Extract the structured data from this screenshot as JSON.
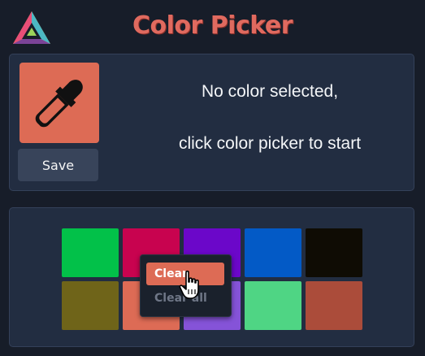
{
  "header": {
    "title": "Color Picker",
    "logo_icon": "prism-triangle-logo-icon"
  },
  "picker": {
    "icon": "eyedropper-icon",
    "button_color": "#dd6b55",
    "save_label": "Save"
  },
  "message": {
    "line1": "No color selected,",
    "line2": "click color picker to start"
  },
  "swatches": [
    {
      "color": "#02c149"
    },
    {
      "color": "#c8034f"
    },
    {
      "color": "#6b07c9"
    },
    {
      "color": "#035ac6"
    },
    {
      "color": "#0f0c04"
    },
    {
      "color": "#6f6419"
    },
    {
      "color": "#dd6b55"
    },
    {
      "color": "#8553d8"
    },
    {
      "color": "#4fd584"
    },
    {
      "color": "#ab4c3a"
    }
  ],
  "context_menu": {
    "clear_label": "Clear",
    "clear_all_label": "Clear all"
  },
  "colors": {
    "background": "#171d29",
    "panel": "#222d41",
    "accent": "#dd6b55",
    "title": "#e06a5f"
  }
}
